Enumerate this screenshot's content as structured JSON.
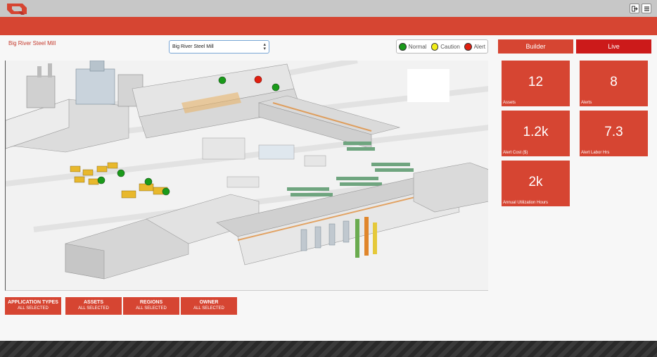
{
  "header": {
    "logout_icon": "logout-icon",
    "menu_icon": "hamburger-menu-icon"
  },
  "site": {
    "title": "Big River Steel Mill",
    "select_value": "Big River Steel Mill"
  },
  "legend": [
    {
      "label": "Normal",
      "color": "#1a9a1a"
    },
    {
      "label": "Caution",
      "color": "#f2ee1a"
    },
    {
      "label": "Alert",
      "color": "#e01f10"
    }
  ],
  "modes": {
    "builder": "Builder",
    "live": "Live"
  },
  "kpis": [
    {
      "value": "12",
      "label": "Assets"
    },
    {
      "value": "8",
      "label": "Alerts"
    },
    {
      "value": "1.2k",
      "label": "Alert Cost ($)"
    },
    {
      "value": "7.3",
      "label": "Alert Labor Hrs"
    },
    {
      "value": "2k",
      "label": "Annual Utilization Hours"
    }
  ],
  "filters": [
    {
      "title": "APPLICATION TYPES",
      "sub": "ALL SELECTED"
    },
    {
      "title": "ASSETS",
      "sub": "ALL SELECTED"
    },
    {
      "title": "REGIONS",
      "sub": "ALL SELECTED"
    },
    {
      "title": "OWNER",
      "sub": "ALL SELECTED"
    }
  ],
  "colors": {
    "brand_red": "#d64532",
    "live_red": "#cc1a1a",
    "normal": "#1a9a1a",
    "caution": "#f2ee1a",
    "alert": "#e01f10"
  }
}
